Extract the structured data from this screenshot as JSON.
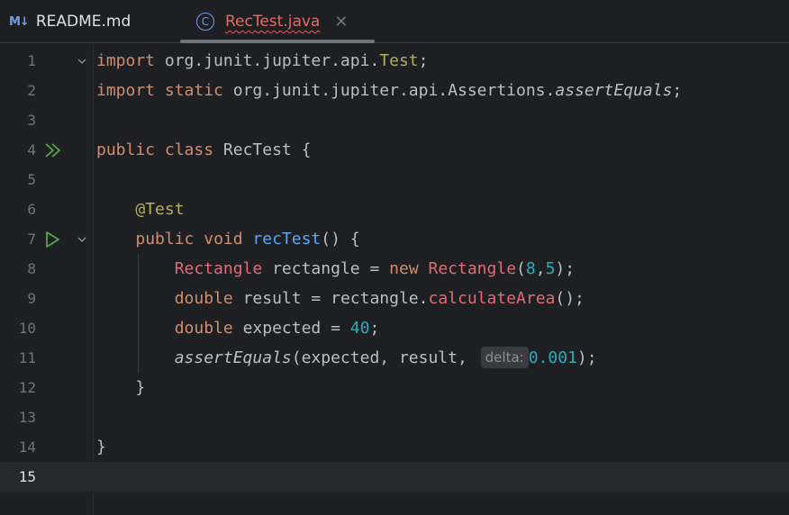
{
  "tabs": [
    {
      "icon": "markdown-icon",
      "icon_text": "M↓",
      "label": "README.md"
    },
    {
      "icon": "java-class-icon",
      "icon_text": "C",
      "label": "RecTest.java",
      "close": "✕"
    }
  ],
  "colors": {
    "background": "#1e1f22",
    "keyword": "#cf8e6d",
    "annotation": "#b3ae60",
    "type": "#e06c75",
    "function": "#56a8f5",
    "number": "#2aacb8"
  },
  "editor": {
    "line_numbers": [
      "1",
      "2",
      "3",
      "4",
      "5",
      "6",
      "7",
      "8",
      "9",
      "10",
      "11",
      "12",
      "13",
      "14",
      "15"
    ],
    "current_line": 15,
    "lines": {
      "l1": {
        "kw": "import",
        "pkg": " org.junit.jupiter.api.",
        "cls": "Test",
        "end": ";"
      },
      "l2": {
        "kw1": "import",
        "kw2": " static",
        "pkg": " org.junit.jupiter.api.Assertions.",
        "m": "assertEquals",
        "end": ";"
      },
      "l4": {
        "kw1": "public",
        "kw2": " class",
        "name": " RecTest {"
      },
      "l6": {
        "ann": "@Test"
      },
      "l7": {
        "kw1": "public",
        "kw2": " void",
        "name": " recTest",
        "rest": "() {"
      },
      "l8": {
        "t1": "Rectangle",
        "a": " rectangle = ",
        "kw": "new",
        "t2": " Rectangle",
        "p1": "(",
        "n1": "8",
        "c": ",",
        "n2": "5",
        "p2": ");"
      },
      "l9": {
        "kw": "double",
        "a": " result = rectangle.",
        "m": "calculateArea",
        "b": "();"
      },
      "l10": {
        "kw": "double",
        "a": " expected = ",
        "n": "40",
        "b": ";"
      },
      "l11": {
        "m": "assertEquals",
        "a": "(expected, result, ",
        "hint": "delta:",
        "n": "0.001",
        "b": ");"
      },
      "l12": {
        "t": "}"
      },
      "l14": {
        "t": "}"
      }
    }
  }
}
